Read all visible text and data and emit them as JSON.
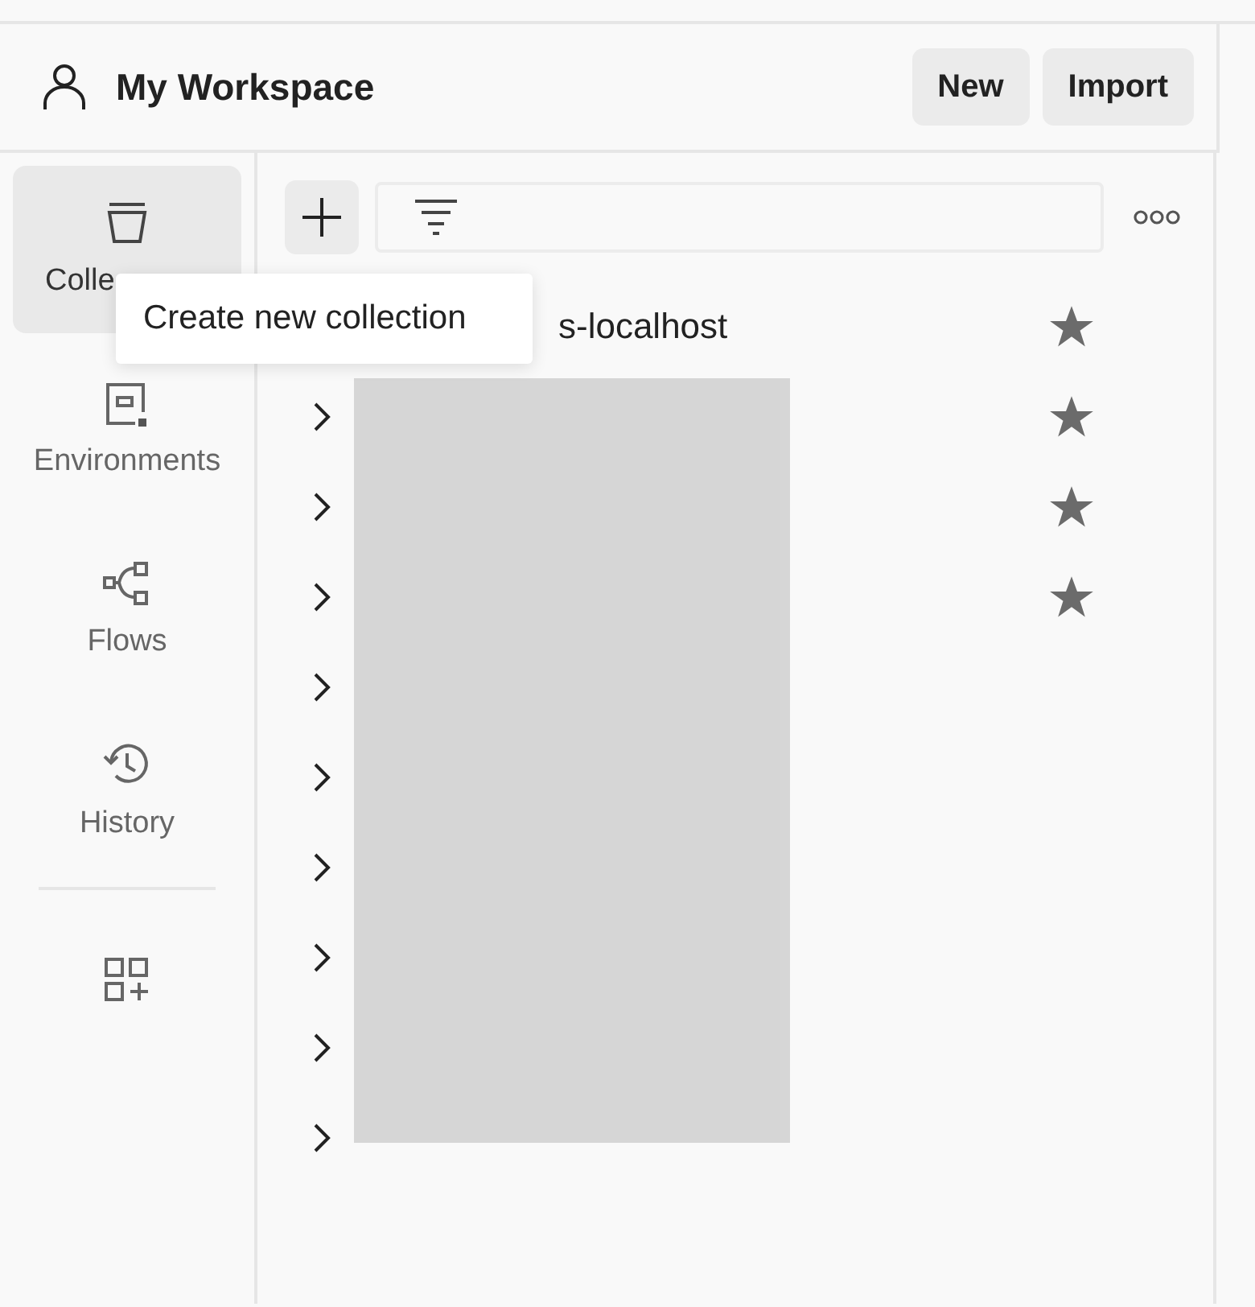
{
  "workspace": {
    "title": "My Workspace"
  },
  "header_buttons": [
    "New",
    "Import"
  ],
  "sidebar": {
    "items": [
      {
        "kind": "collections",
        "label": "Colle",
        "selected": true
      },
      {
        "kind": "environments",
        "label": "Environments",
        "selected": false
      },
      {
        "kind": "flows",
        "label": "Flows",
        "selected": false
      },
      {
        "kind": "history",
        "label": "History",
        "selected": false
      },
      {
        "kind": "apps",
        "selected": false
      }
    ]
  },
  "tooltip": "Create new collection",
  "collections": {
    "redacted": true,
    "rows": [
      {
        "name": "s-localhost",
        "favorite": true
      },
      {
        "favorite": true
      },
      {
        "favorite": true
      },
      {
        "favorite": true
      },
      {
        "favorite": false
      },
      {
        "favorite": false
      },
      {
        "favorite": false
      },
      {
        "favorite": false
      },
      {
        "favorite": false
      },
      {
        "favorite": false
      }
    ]
  }
}
